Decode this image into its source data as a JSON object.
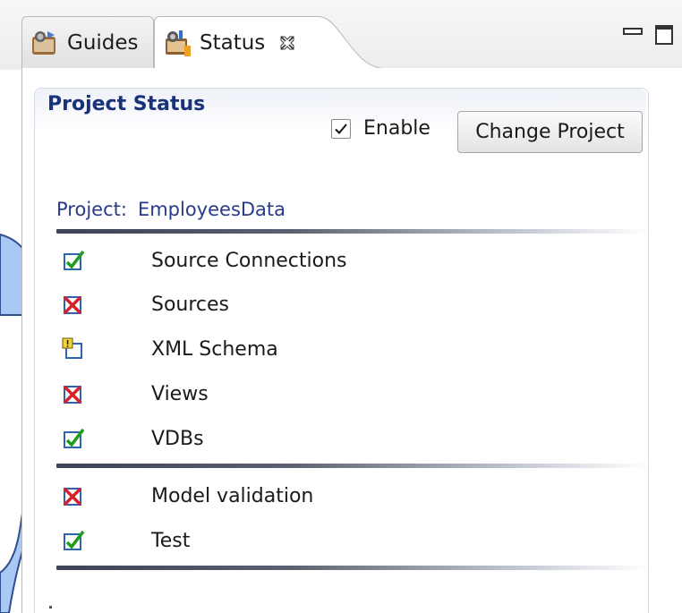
{
  "tabs": [
    {
      "label": "Guides",
      "icon": "guides-icon",
      "active": false
    },
    {
      "label": "Status",
      "icon": "status-icon",
      "active": true
    }
  ],
  "view_controls": {
    "minimize_icon": "minimize-icon",
    "maximize_icon": "maximize-icon"
  },
  "section": {
    "title": "Project Status",
    "enable_label": "Enable",
    "enable_checked": true,
    "change_button_label": "Change Project"
  },
  "project": {
    "label": "Project:",
    "name": "EmployeesData"
  },
  "groups": [
    {
      "items": [
        {
          "label": "Source Connections",
          "status": "ok"
        },
        {
          "label": "Sources",
          "status": "error"
        },
        {
          "label": "XML Schema",
          "status": "warning"
        },
        {
          "label": "Views",
          "status": "error"
        },
        {
          "label": "VDBs",
          "status": "ok"
        }
      ]
    },
    {
      "items": [
        {
          "label": "Model validation",
          "status": "error"
        },
        {
          "label": "Test",
          "status": "ok"
        }
      ]
    }
  ],
  "colors": {
    "ok": "#1e9e1e",
    "error": "#d8202a",
    "warning": "#e0b800",
    "box": "#2e63b0",
    "callout_fill": "#aac8f4",
    "callout_stroke": "#2f4f8e",
    "title": "#19337a"
  }
}
